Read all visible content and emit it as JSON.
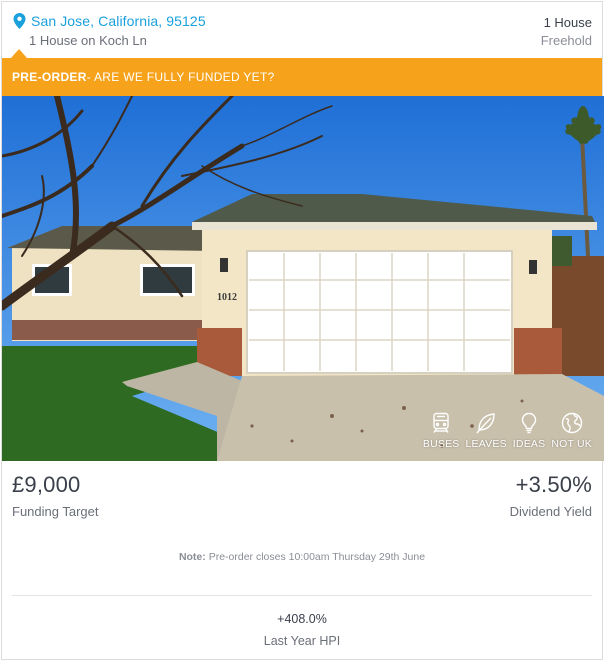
{
  "location": {
    "city_line": "San Jose, California, 95125",
    "address": "1 House on Koch Ln",
    "property_type": "1 House",
    "tenure": "Freehold"
  },
  "banner": {
    "label": "PRE-ORDER",
    "text": " - ARE WE FULLY FUNDED YET?"
  },
  "photo": {
    "house_number": "1012"
  },
  "tags": [
    {
      "label": "BUSES",
      "icon": "train-icon"
    },
    {
      "label": "LEAVES",
      "icon": "leaf-icon"
    },
    {
      "label": "IDEAS",
      "icon": "lightbulb-icon"
    },
    {
      "label": "NOT UK",
      "icon": "globe-icon"
    }
  ],
  "stats": {
    "funding_target_value": "£9,000",
    "funding_target_label": "Funding Target",
    "dividend_yield_value": "+3.50%",
    "dividend_yield_label": "Dividend Yield"
  },
  "note": {
    "label": "Note:",
    "text": " Pre-order closes 10:00am Thursday 29th June"
  },
  "hpi": {
    "value": "+408.0%",
    "label": "Last Year HPI"
  },
  "colors": {
    "accent_blue": "#1aa0dc",
    "banner_orange": "#f7a21b"
  }
}
